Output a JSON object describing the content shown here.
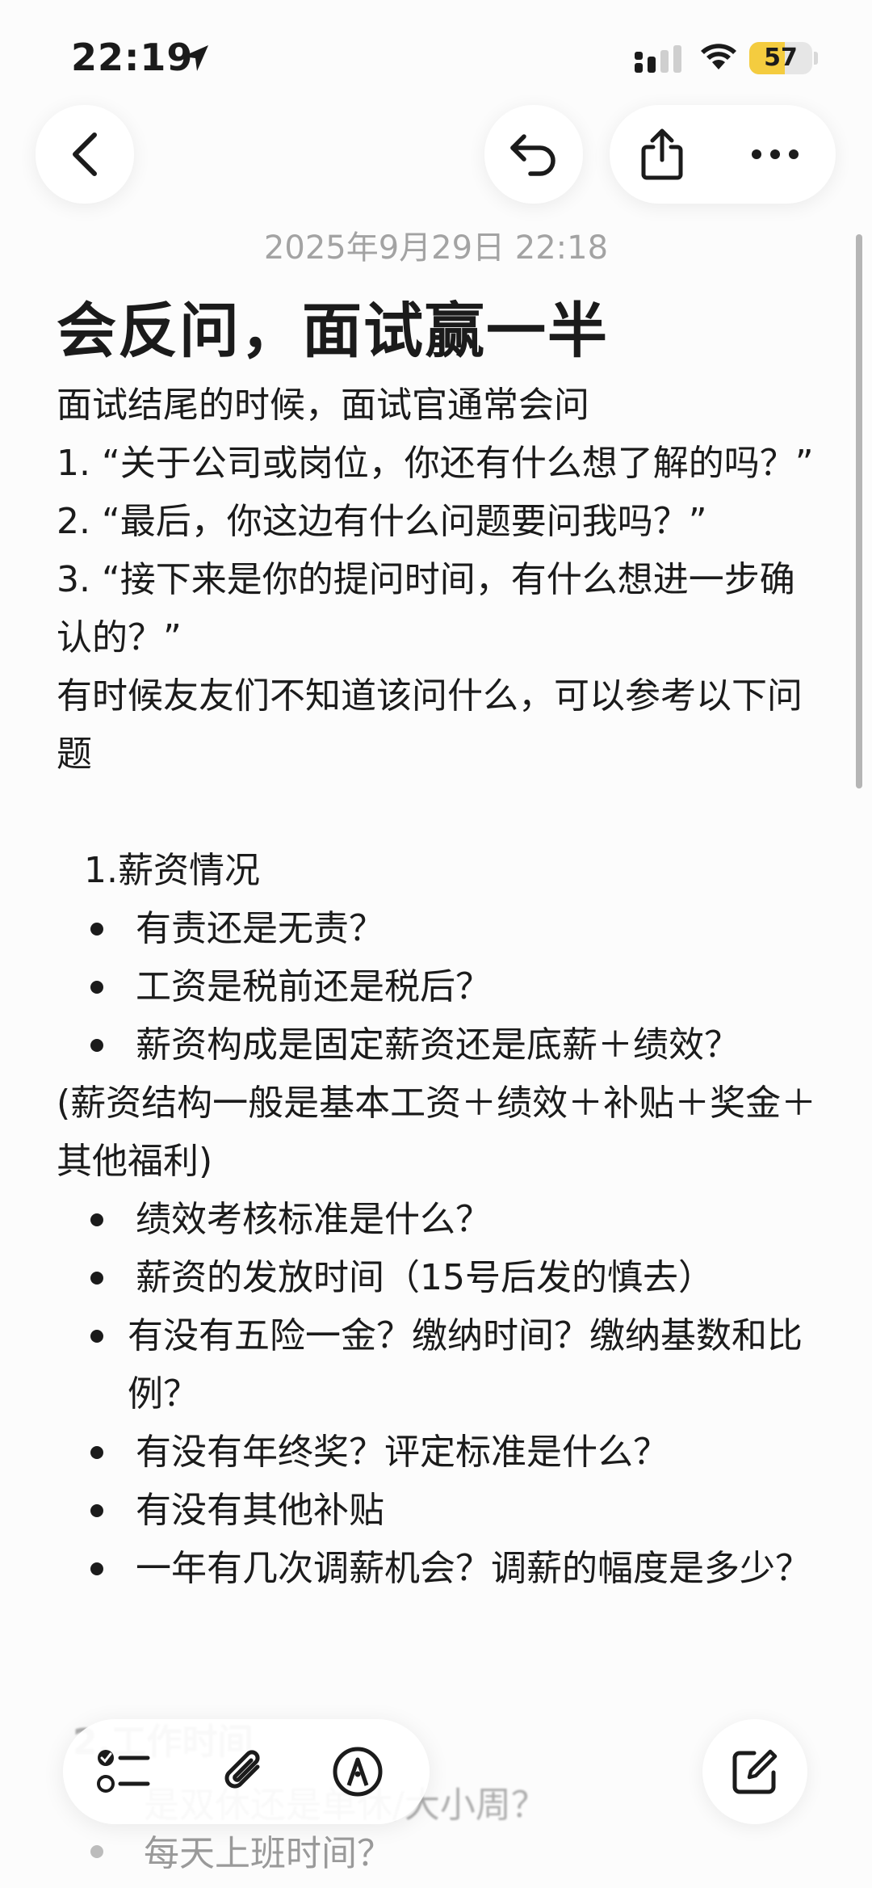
{
  "status_bar": {
    "time": "22:19",
    "battery": "57",
    "battery_level": 0.57
  },
  "nav": {
    "back": "back",
    "undo": "undo",
    "share": "share",
    "more": "more"
  },
  "note": {
    "date": "2025年9月29日 22:18",
    "title": "会反问，面试赢一半",
    "intro": [
      "面试结尾的时候，面试官通常会问",
      "1. “关于公司或岗位，你还有什么想了解的吗？”",
      "2. “最后，你这边有什么问题要问我吗？”",
      "3. “接下来是你的提问时间，有什么想进一步确认的？”",
      "有时候友友们不知道该问什么，可以参考以下问题"
    ],
    "section1": {
      "heading": "1.薪资情况",
      "bullets_a": [
        " 有责还是无责？",
        " 工资是税前还是税后？",
        " 薪资构成是固定薪资还是底薪＋绩效？"
      ],
      "note": "(薪资结构一般是基本工资＋绩效＋补贴＋奖金＋其他福利)",
      "bullets_b": [
        " 绩效考核标准是什么？",
        " 薪资的发放时间（15号后发的慎去）",
        " 有没有五险一金？缴纳时间？缴纳基数和比例？",
        "有没有年终奖？评定标准是什么？",
        "有没有其他补贴",
        "一年有几次调薪机会？调薪的幅度是多少？"
      ]
    },
    "faded": {
      "heading": "2.工作时间",
      "line1": "是双休还是单休/大小周？",
      "line2": "每天上班时间？"
    }
  },
  "toolbar": {
    "checklist": "checklist",
    "attach": "attachment",
    "markup": "markup",
    "compose": "compose"
  }
}
